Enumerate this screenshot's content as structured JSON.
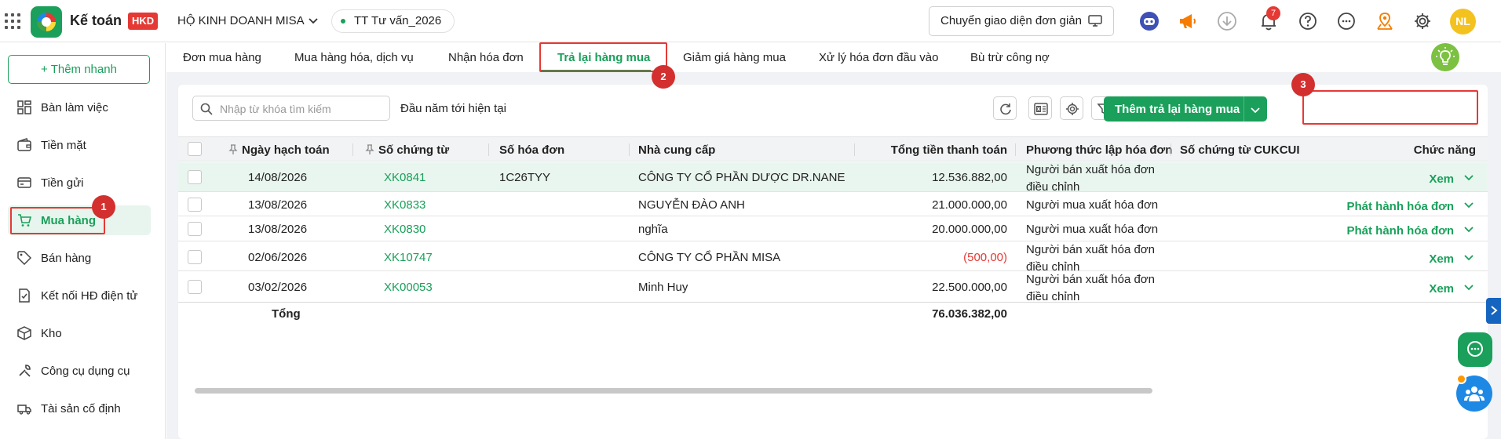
{
  "header": {
    "app_title": "Kế toán",
    "badge": "HKD",
    "org_name": "HỘ KINH DOANH MISA",
    "database": "TT Tư vấn_2026",
    "switch_ui_label": "Chuyển giao diện đơn giản",
    "notification_count": "7",
    "avatar_initials": "NL"
  },
  "sidebar": {
    "add_quick_label": "+ Thêm nhanh",
    "items": [
      {
        "label": "Bàn làm việc",
        "icon": "dashboard-icon"
      },
      {
        "label": "Tiền mặt",
        "icon": "wallet-icon"
      },
      {
        "label": "Tiền gửi",
        "icon": "bank-card-icon"
      },
      {
        "label": "Mua hàng",
        "icon": "cart-icon"
      },
      {
        "label": "Bán hàng",
        "icon": "tag-icon"
      },
      {
        "label": "Kết nối HĐ điện tử",
        "icon": "e-invoice-icon"
      },
      {
        "label": "Kho",
        "icon": "box-icon"
      },
      {
        "label": "Công cụ dụng cụ",
        "icon": "tools-icon"
      },
      {
        "label": "Tài sản cố định",
        "icon": "truck-icon"
      }
    ]
  },
  "tabs": [
    {
      "label": "Đơn mua hàng"
    },
    {
      "label": "Mua hàng hóa, dịch vụ"
    },
    {
      "label": "Nhận hóa đơn"
    },
    {
      "label": "Trả lại hàng mua"
    },
    {
      "label": "Giảm giá hàng mua"
    },
    {
      "label": "Xử lý hóa đơn đầu vào"
    },
    {
      "label": "Bù trừ công nợ"
    }
  ],
  "toolbar": {
    "search_placeholder": "Nhập từ khóa tìm kiếm",
    "period": "Đầu năm tới hiện tại",
    "add_button": "Thêm trả lại hàng mua"
  },
  "table": {
    "columns": {
      "date": "Ngày hạch toán",
      "voucher": "Số chứng từ",
      "invoice": "Số hóa đơn",
      "supplier": "Nhà cung cấp",
      "total": "Tổng tiền thanh toán",
      "method": "Phương thức lập hóa đơn",
      "cukcui": "Số chứng từ CUKCUI",
      "action": "Chức năng"
    },
    "rows": [
      {
        "date": "14/08/2026",
        "voucher": "XK0841",
        "invoice": "1C26TYY",
        "supplier": "CÔNG TY CỔ PHẦN DƯỢC DR.NANE",
        "total": "12.536.882,00",
        "method": "Người bán xuất hóa đơn điều chỉnh",
        "action": "Xem"
      },
      {
        "date": "13/08/2026",
        "voucher": "XK0833",
        "invoice": "",
        "supplier": "NGUYỄN ĐÀO ANH",
        "total": "21.000.000,00",
        "method": "Người mua xuất hóa đơn",
        "action": "Phát hành hóa đơn"
      },
      {
        "date": "13/08/2026",
        "voucher": "XK0830",
        "invoice": "",
        "supplier": "nghĩa",
        "total": "20.000.000,00",
        "method": "Người mua xuất hóa đơn",
        "action": "Phát hành hóa đơn"
      },
      {
        "date": "02/06/2026",
        "voucher": "XK10747",
        "invoice": "",
        "supplier": "CÔNG TY CỔ PHẦN MISA",
        "total": "(500,00)",
        "method": "Người bán xuất hóa đơn điều chỉnh",
        "action": "Xem"
      },
      {
        "date": "03/02/2026",
        "voucher": "XK00053",
        "invoice": "",
        "supplier": "Minh Huy",
        "total": "22.500.000,00",
        "method": "Người bán xuất hóa đơn điều chỉnh",
        "action": "Xem"
      }
    ],
    "total_label": "Tổng",
    "total_value": "76.036.382,00"
  },
  "annotations": [
    "1",
    "2",
    "3"
  ],
  "colors": {
    "brand": "#1aa05a",
    "marker": "#d32f2f",
    "negative": "#e53935",
    "highlight_row": "#e9f6ef"
  }
}
